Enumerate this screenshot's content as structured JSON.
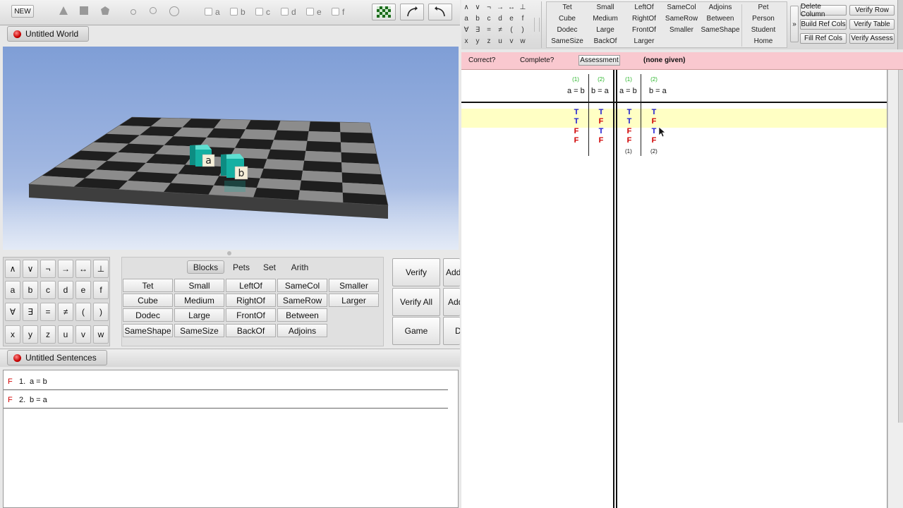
{
  "left_toolbar": {
    "new_label": "NEW",
    "checkbox_labels": [
      "a",
      "b",
      "c",
      "d",
      "e",
      "f"
    ]
  },
  "world": {
    "title": "Untitled World",
    "labels": [
      "a",
      "b"
    ]
  },
  "keypad": {
    "rows": [
      [
        "∧",
        "∨",
        "¬",
        "→",
        "↔",
        "⊥"
      ],
      [
        "a",
        "b",
        "c",
        "d",
        "e",
        "f"
      ],
      [
        "∀",
        "∃",
        "=",
        "≠",
        "(",
        ")"
      ],
      [
        "x",
        "y",
        "z",
        "u",
        "v",
        "w"
      ]
    ],
    "tabs": [
      "Blocks",
      "Pets",
      "Set",
      "Arith"
    ],
    "active_tab": "Blocks",
    "predicates": [
      [
        "Tet",
        "Small",
        "LeftOf",
        "SameCol",
        "Smaller"
      ],
      [
        "Cube",
        "Medium",
        "RightOf",
        "SameRow",
        "Larger"
      ],
      [
        "Dodec",
        "Large",
        "FrontOf",
        "Between"
      ],
      [
        "SameShape",
        "SameSize",
        "BackOf",
        "Adjoins"
      ]
    ],
    "verify": "Verify",
    "verify_all": "Verify All",
    "game": "Game",
    "add_cut_1": "Add",
    "add_cut_2": "Add",
    "d_cut": "D"
  },
  "sentences": {
    "title": "Untitled Sentences",
    "items": [
      {
        "value": "F",
        "num": "1.",
        "text": "a = b"
      },
      {
        "value": "F",
        "num": "2.",
        "text": "b = a"
      }
    ]
  },
  "right_toolbar": {
    "symbols": [
      [
        "∧",
        "∨",
        "¬",
        "→",
        "↔",
        "⊥"
      ],
      [
        "a",
        "b",
        "c",
        "d",
        "e",
        "f"
      ],
      [
        "∀",
        "∃",
        "=",
        "≠",
        "(",
        ")"
      ],
      [
        "x",
        "y",
        "z",
        "u",
        "v",
        "w"
      ]
    ],
    "predicates": [
      [
        "Tet",
        "Small",
        "LeftOf",
        "SameCol",
        "Adjoins"
      ],
      [
        "Cube",
        "Medium",
        "RightOf",
        "SameRow",
        "Between"
      ],
      [
        "Dodec",
        "Large",
        "FrontOf",
        "Smaller",
        "SameShape"
      ],
      [
        "SameSize",
        "BackOf",
        "Larger"
      ]
    ],
    "pets": [
      "Pet",
      "Person",
      "Student",
      "Home"
    ],
    "more": "»",
    "buttons": {
      "delete_column": "Delete Column",
      "verify_row": "Verify Row",
      "build_ref_cols": "Build Ref Cols",
      "verify_table": "Verify Table",
      "fill_ref_cols": "Fill Ref Cols",
      "verify_assess": "Verify Assess"
    }
  },
  "assessment": {
    "correct": "Correct?",
    "complete": "Complete?",
    "button": "Assessment",
    "value": "(none given)"
  },
  "truth_table": {
    "ref_headers": [
      {
        "num": "(1)",
        "label": "a = b"
      },
      {
        "num": "(2)",
        "label": "b = a"
      }
    ],
    "main_headers": [
      {
        "num": "(1)",
        "label": "a = b"
      },
      {
        "num": "(2)",
        "label": "b = a"
      }
    ],
    "ref_rows": [
      [
        "T",
        "T"
      ],
      [
        "T",
        "F"
      ],
      [
        "F",
        "T"
      ],
      [
        "F",
        "F"
      ]
    ],
    "main_rows": [
      [
        "T",
        "T"
      ],
      [
        "T",
        "F"
      ],
      [
        "F",
        "T"
      ],
      [
        "F",
        "F"
      ]
    ],
    "footer": [
      "(1)",
      "(2)"
    ],
    "highlight_rows": 2
  }
}
